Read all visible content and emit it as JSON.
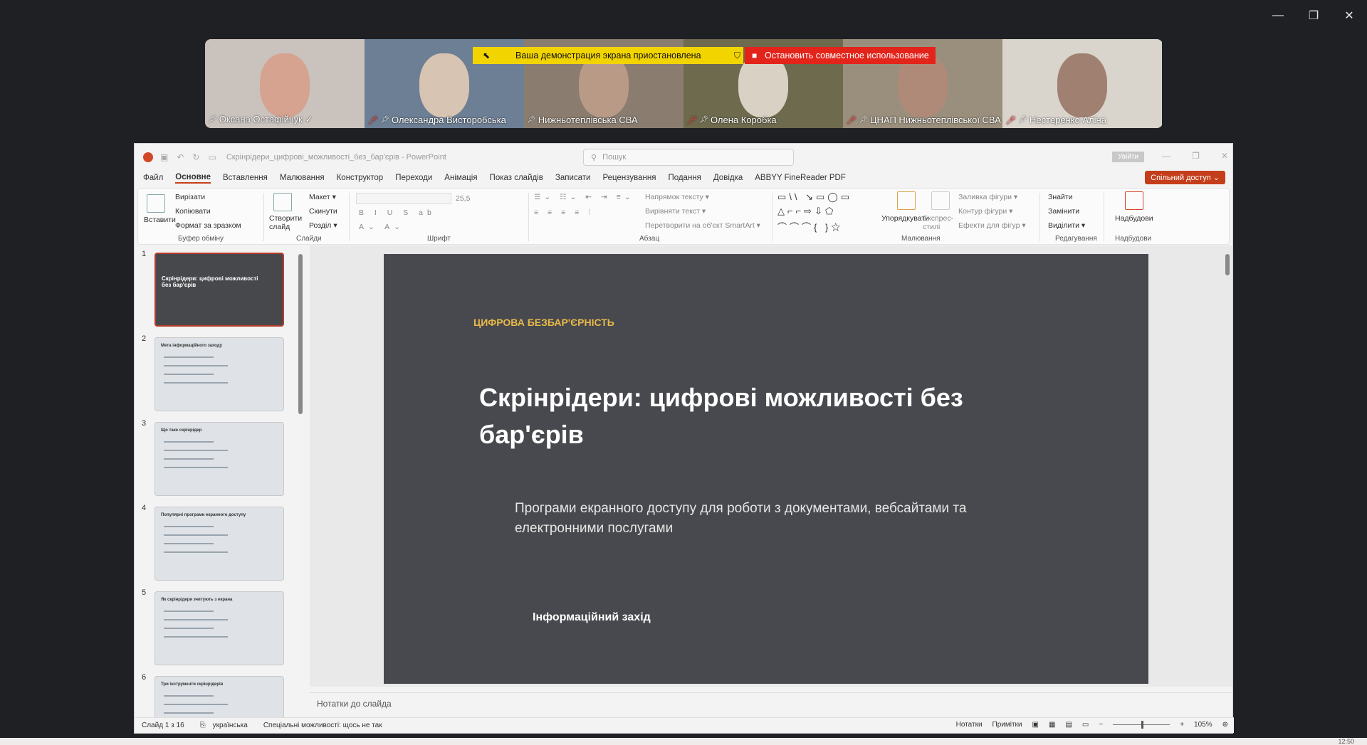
{
  "window_controls": {
    "minimize": "—",
    "restore": "❐",
    "close": "✕"
  },
  "banners": {
    "paused": "Ваша демонстрация экрана приостановлена",
    "stop": "Остановить совместное использование"
  },
  "participants": [
    {
      "name": "Оксана Остафійчук ✓",
      "bg": "#c9c2bd",
      "face": "#d6a391",
      "muted": false
    },
    {
      "name": "Олександра Висторобська",
      "bg": "#6d7f94",
      "face": "#d8c4b2",
      "muted": true
    },
    {
      "name": "Нижньотеплівська СВА",
      "bg": "#8a7d70",
      "face": "#b89a86",
      "muted": false
    },
    {
      "name": "Олена Коробка",
      "bg": "#6e6a4e",
      "face": "#d9d2c4",
      "muted": true
    },
    {
      "name": "ЦНАП Нижньотеплівської СВА",
      "bg": "#9a8f7c",
      "face": "#b08a78",
      "muted": true
    },
    {
      "name": "Нестеренко Аліна",
      "bg": "#d9d4cc",
      "face": "#a08070",
      "muted": true
    }
  ],
  "ppt": {
    "file_title": "Скрінрідери_цифрові_можливості_без_бар'єрів  -  PowerPoint",
    "search_placeholder": "Пошук",
    "signin": "Увійти",
    "tabs": [
      "Файл",
      "Основне",
      "Вставлення",
      "Малювання",
      "Конструктор",
      "Переходи",
      "Анімація",
      "Показ слайдів",
      "Записати",
      "Рецензування",
      "Подання",
      "Довідка",
      "ABBYY FineReader PDF"
    ],
    "share": "Спільний доступ ⌄",
    "ribbon": {
      "paste": "Вставити",
      "cut": "Вирізати",
      "copy": "Копіювати",
      "format_painter": "Формат за зразком",
      "clipboard_group": "Буфер обміну",
      "new_slide": "Створити слайд",
      "layout": "Макет ▾",
      "reset": "Скинути",
      "section": "Розділ ▾",
      "slides_group": "Слайди",
      "font_size": "25,5",
      "font_group": "Шрифт",
      "text_direction": "Напрямок тексту ▾",
      "align_text": "Вирівняти текст ▾",
      "smartart": "Перетворити на об'єкт SmartArt ▾",
      "paragraph_group": "Абзац",
      "arrange": "Упорядкувати",
      "quick_styles": "Експрес-стилі",
      "shape_fill": "Заливка фігури ▾",
      "shape_outline": "Контур фігури ▾",
      "shape_effects": "Ефекти для фігур ▾",
      "drawing_group": "Малювання",
      "find": "Знайти",
      "replace": "Замінити",
      "select": "Виділити ▾",
      "editing_group": "Редагування",
      "addins": "Надбудови",
      "addins_group": "Надбудови"
    },
    "thumbnails": [
      {
        "num": "1",
        "title": "Скрінрідери: цифрові можливості без бар'єрів"
      },
      {
        "num": "2",
        "title": "Мета інформаційного заходу"
      },
      {
        "num": "3",
        "title": "Що таке скрінрідер"
      },
      {
        "num": "4",
        "title": "Популярні програми екранного доступу"
      },
      {
        "num": "5",
        "title": "Як скрінрідери зчитують з екрана"
      },
      {
        "num": "6",
        "title": "Три інструменти скрінрідерів"
      }
    ],
    "slide": {
      "kicker": "ЦИФРОВА БЕЗБАР'ЄРНІСТЬ",
      "title": "Скрінрідери: цифрові можливості без бар'єрів",
      "subtitle": "Програми екранного доступу для роботи з документами, вебсайтами та електронними послугами",
      "footer": "Інформаційний захід"
    },
    "notes_placeholder": "Нотатки до слайда",
    "status": {
      "slide_counter": "Слайд 1 з 16",
      "language": "українська",
      "accessibility": "Спеціальні можливості: щось не так",
      "notes": "Нотатки",
      "comments": "Примітки",
      "zoom": "105%"
    }
  },
  "clock": "12:50"
}
